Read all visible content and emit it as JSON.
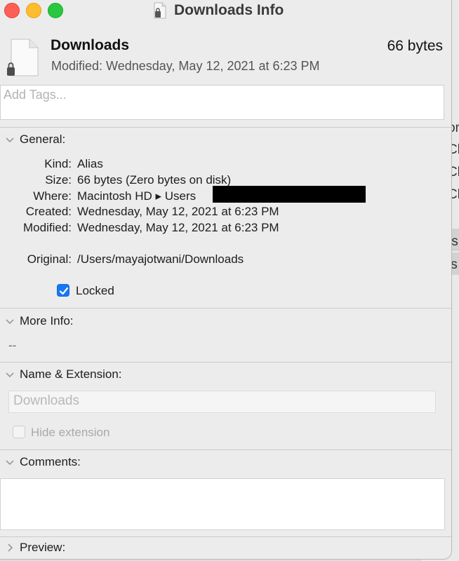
{
  "window": {
    "title": "Downloads Info"
  },
  "header": {
    "file_name": "Downloads",
    "file_size": "66 bytes",
    "modified": "Modified: Wednesday, May 12, 2021 at 6:23 PM"
  },
  "tags": {
    "placeholder": "Add Tags..."
  },
  "general": {
    "heading": "General:",
    "rows": [
      {
        "label": "Kind:",
        "value": "Alias"
      },
      {
        "label": "Size:",
        "value": "66 bytes (Zero bytes on disk)"
      },
      {
        "label": "Where:",
        "value": "Macintosh HD ▸ Users"
      },
      {
        "label": "Created:",
        "value": "Wednesday, May 12, 2021 at 6:23 PM"
      },
      {
        "label": "Modified:",
        "value": "Wednesday, May 12, 2021 at 6:23 PM"
      },
      {
        "label": "Original:",
        "value": "/Users/mayajotwani/Downloads"
      }
    ],
    "locked_label": "Locked",
    "locked_checked": true
  },
  "more_info": {
    "heading": "More Info:",
    "value": "--"
  },
  "name_extension": {
    "heading": "Name & Extension:",
    "name_value": "Downloads",
    "hide_extension_label": "Hide extension",
    "hide_extension_checked": false
  },
  "comments": {
    "heading": "Comments:"
  },
  "preview": {
    "heading": "Preview:"
  },
  "background_window": {
    "fragments": [
      "on",
      "Cl",
      "Cl",
      "Cl",
      "ts",
      "ls"
    ]
  },
  "colors": {
    "accent": "#1677f5",
    "close": "#fe5f57",
    "minimize": "#febc2e",
    "zoom": "#28c840"
  }
}
